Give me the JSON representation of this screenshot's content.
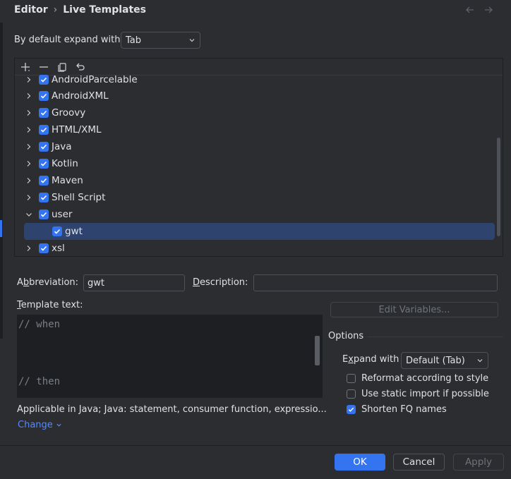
{
  "breadcrumb": {
    "parent": "Editor",
    "separator": "›",
    "current": "Live Templates"
  },
  "expand_default": {
    "label": "By default expand with",
    "value": "Tab"
  },
  "tree": {
    "items": [
      {
        "label": "AndroidParcelable",
        "checked": true,
        "expanded": false
      },
      {
        "label": "AndroidXML",
        "checked": true,
        "expanded": false
      },
      {
        "label": "Groovy",
        "checked": true,
        "expanded": false
      },
      {
        "label": "HTML/XML",
        "checked": true,
        "expanded": false
      },
      {
        "label": "Java",
        "checked": true,
        "expanded": false
      },
      {
        "label": "Kotlin",
        "checked": true,
        "expanded": false
      },
      {
        "label": "Maven",
        "checked": true,
        "expanded": false
      },
      {
        "label": "Shell Script",
        "checked": true,
        "expanded": false
      },
      {
        "label": "user",
        "checked": true,
        "expanded": true
      },
      {
        "label": "gwt",
        "checked": true,
        "child": true,
        "selected": true
      },
      {
        "label": "xsl",
        "checked": true,
        "expanded": false
      }
    ]
  },
  "abbreviation": {
    "label_pre": "A",
    "label_u": "b",
    "label_post": "breviation:",
    "value": "gwt"
  },
  "description": {
    "label_u": "D",
    "label_post": "escription:",
    "value": ""
  },
  "template_text": {
    "label_u": "T",
    "label_post": "emplate text:",
    "line1": "// when",
    "line2": "// then"
  },
  "edit_variables_label": "Edit Variables...",
  "options": {
    "title": "Options",
    "expand_with": {
      "label_pre": "E",
      "label_u": "x",
      "label_post": "pand with",
      "value": "Default (Tab)"
    },
    "reformat": {
      "label": "Reformat according to style",
      "checked": false
    },
    "static_import": {
      "label": "Use static import if possible",
      "checked": false
    },
    "shorten_fq": {
      "label": "Shorten FQ names",
      "checked": true
    }
  },
  "applicable_text": "Applicable in Java; Java: statement, consumer function, expressio...",
  "change_label": "Change",
  "buttons": {
    "ok": "OK",
    "cancel": "Cancel",
    "apply": "Apply"
  },
  "colors": {
    "accent": "#3574f0",
    "selection": "#2e436e",
    "background": "#2b2d30",
    "editor_bg": "#1e1f22",
    "link": "#548af7"
  }
}
